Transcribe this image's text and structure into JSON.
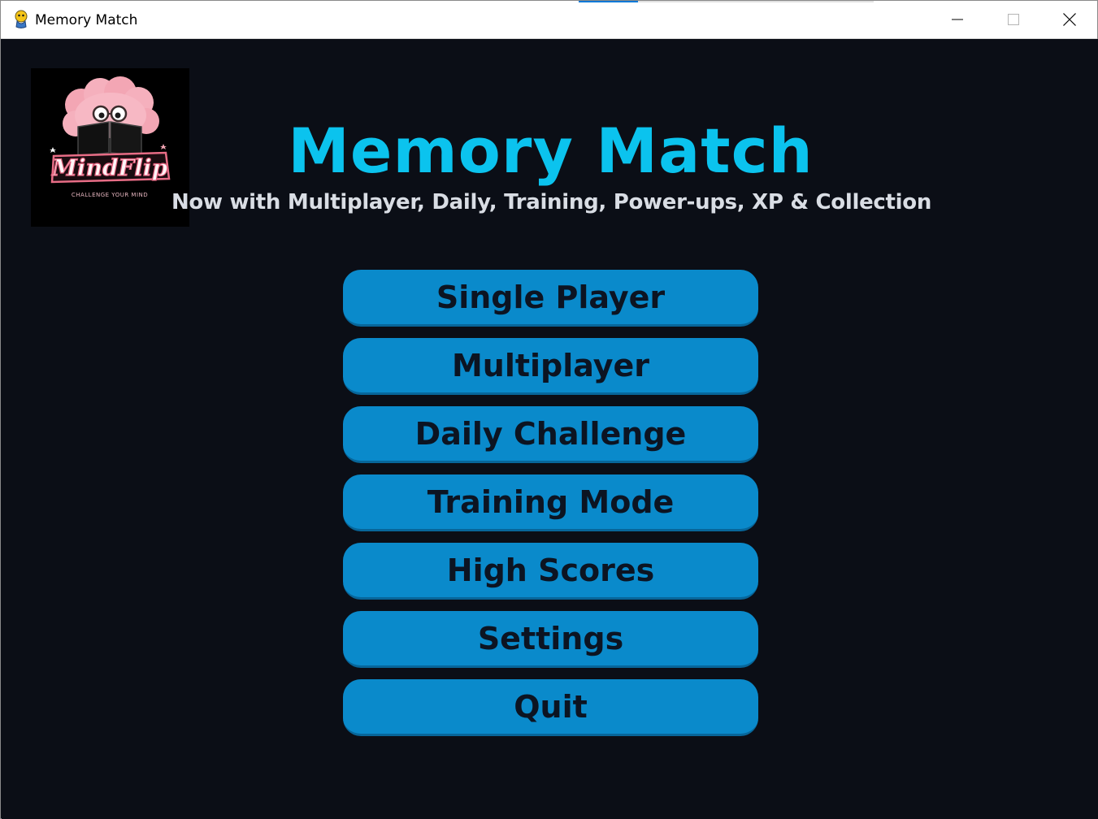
{
  "window": {
    "title": "Memory Match",
    "controls": {
      "minimize_icon": "minimize-icon",
      "maximize_icon": "maximize-icon",
      "close_icon": "close-icon"
    }
  },
  "header": {
    "logo_text": "MindFlip",
    "logo_tagline": "CHALLENGE YOUR MIND",
    "title": "Memory Match",
    "tagline": "Now with Multiplayer, Daily, Training, Power-ups, XP & Collection"
  },
  "menu": {
    "items": [
      {
        "label": "Single Player"
      },
      {
        "label": "Multiplayer"
      },
      {
        "label": "Daily Challenge"
      },
      {
        "label": "Training Mode"
      },
      {
        "label": "High Scores"
      },
      {
        "label": "Settings"
      },
      {
        "label": "Quit"
      }
    ]
  },
  "colors": {
    "background": "#0b0e16",
    "title": "#0bc3ee",
    "button": "#0a8acb",
    "button_text": "#0c1422",
    "tagline": "#d9dde4"
  }
}
